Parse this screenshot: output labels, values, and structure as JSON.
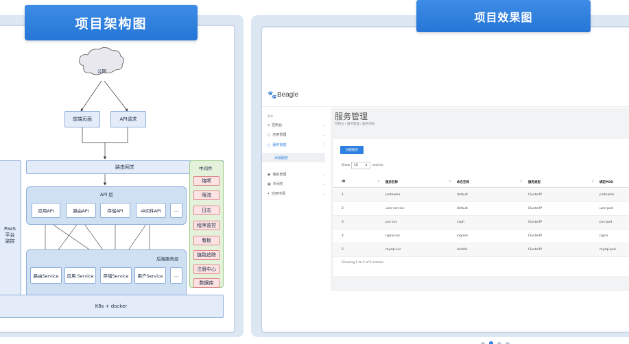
{
  "left": {
    "title": "项目架构图",
    "diagram": {
      "cloud": "公网",
      "web": "前端页面",
      "api_req": "API请求",
      "gateway": "路由网关",
      "api_layer": "API 层",
      "apis": [
        "应用API",
        "路由API",
        "存储API",
        "中间件API",
        "..."
      ],
      "backend_label": "后端服务层",
      "services": [
        "路由Service",
        "应用 Service",
        "存储Service",
        "用户Service",
        "..."
      ],
      "paas": "PaaS\n平台\n监控",
      "k8s": "K8s + docker",
      "middleware_title": "中间件",
      "middleware": [
        "熔断",
        "限流",
        "日志",
        "程序监控",
        "看板",
        "链路追踪",
        "注册中心",
        "数据库"
      ]
    }
  },
  "right": {
    "title": "项目效果图",
    "app": {
      "logo": "Beagle",
      "sidebar_header": "菜单",
      "sidebar_items": [
        {
          "label": "控制台",
          "icon": "home-icon"
        },
        {
          "label": "应用管理",
          "icon": "app-icon"
        },
        {
          "label": "服务管理",
          "icon": "service-icon"
        },
        {
          "label": "添加服务",
          "icon": ""
        },
        {
          "label": "域名管理",
          "icon": "domain-icon"
        },
        {
          "label": "中间件",
          "icon": "middleware-icon"
        },
        {
          "label": "应用市场",
          "icon": "market-icon"
        }
      ],
      "page_title": "服务管理",
      "breadcrumb": "控制台 / 服务管理 / 服务列表",
      "create_button": "创建服务",
      "show_label": "Show",
      "show_value": "10",
      "entries_label": "entries",
      "columns": [
        "ID",
        "服务名称",
        "命名空间",
        "服务类型",
        "绑定POD"
      ],
      "rows": [
        [
          "1",
          "podname",
          "default",
          "ClusterIP",
          "podname"
        ],
        [
          "2",
          "user-service",
          "default",
          "ClusterIP",
          "user-pod"
        ],
        [
          "3",
          "pvc-svc",
          "ceph",
          "ClusterIP",
          "pvc-pod"
        ],
        [
          "4",
          "nginx-svc",
          "ingress",
          "ClusterIP",
          "nginx"
        ],
        [
          "5",
          "mysql-svc",
          "middle",
          "ClusterIP",
          "mysql-pod"
        ]
      ],
      "footer": "Showing 1 to 5 of 5 entries"
    }
  },
  "colors": {
    "accent": "#2f80e0",
    "panel_bg": "#dde7f4"
  }
}
